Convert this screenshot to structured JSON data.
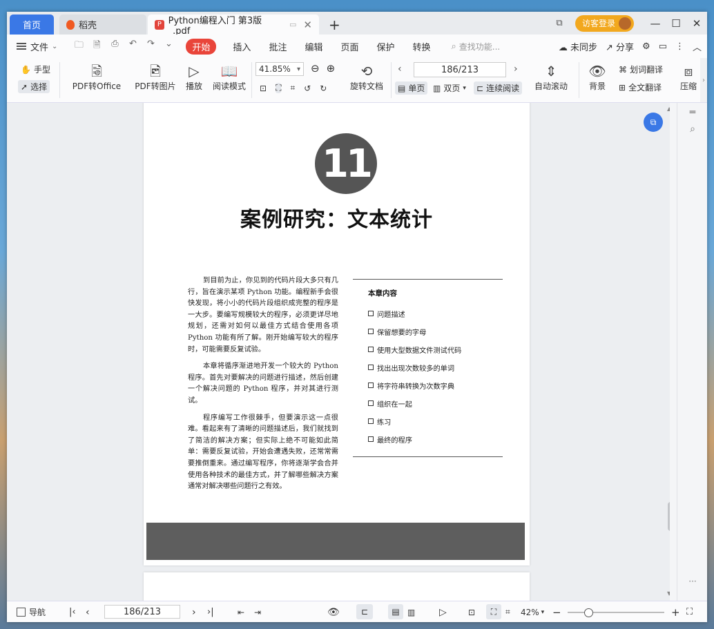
{
  "tabs": {
    "home": "首页",
    "daoke": "稻壳",
    "document": "Python编程入门 第3版_.pdf"
  },
  "title_bar": {
    "login": "访客登录"
  },
  "menu": {
    "file": "文件",
    "items": [
      "开始",
      "插入",
      "批注",
      "编辑",
      "页面",
      "保护",
      "转换"
    ],
    "search_placeholder": "查找功能...",
    "sync": "未同步",
    "share": "分享"
  },
  "ribbon": {
    "hand": "手型",
    "select": "选择",
    "pdf_to_office": "PDF转Office",
    "pdf_to_image": "PDF转图片",
    "play": "播放",
    "read_mode": "阅读模式",
    "zoom": "41.85%",
    "rotate": "旋转文档",
    "page_indicator": "186/213",
    "single": "单页",
    "double": "双页",
    "continuous": "连续阅读",
    "auto_scroll": "自动滚动",
    "background": "背景",
    "word_translate": "划词翻译",
    "full_translate": "全文翻译",
    "compress": "压缩"
  },
  "document": {
    "chapter_number": "11",
    "chapter_title": "案例研究：文本统计",
    "paragraphs": [
      "到目前为止，你见到的代码片段大多只有几行，旨在演示某项 Python 功能。编程新手会很快发现，将小小的代码片段组织成完整的程序是一大步。要编写规模较大的程序，必须更详尽地规划，还需对如何以最佳方式结合使用各项 Python 功能有所了解。刚开始编写较大的程序时，可能需要反复试验。",
      "本章将循序渐进地开发一个较大的 Python 程序。首先对要解决的问题进行描述，然后创建一个解决问题的 Python 程序，并对其进行测试。",
      "程序编写工作很棘手，但要演示这一点很难。看起来有了清晰的问题描述后，我们就找到了简洁的解决方案；但实际上绝不可能如此简单：需要反复试验，开始会遭遇失败，还常常需要推倒重来。通过编写程序，你将逐渐学会合并使用各种技术的最佳方式，并了解哪些解决方案通常对解决哪些问题行之有效。"
    ],
    "toc_heading": "本章内容",
    "toc_items": [
      "问题描述",
      "保留想要的字母",
      "使用大型数据文件测试代码",
      "找出出现次数较多的单词",
      "将字符串转换为次数字典",
      "组织在一起",
      "练习",
      "最终的程序"
    ]
  },
  "statusbar": {
    "nav": "导航",
    "page_indicator": "186/213",
    "zoom": "42%"
  },
  "colors": {
    "accent": "#3a78e6",
    "active_menu": "#e9453a",
    "login": "#f2a81e"
  }
}
